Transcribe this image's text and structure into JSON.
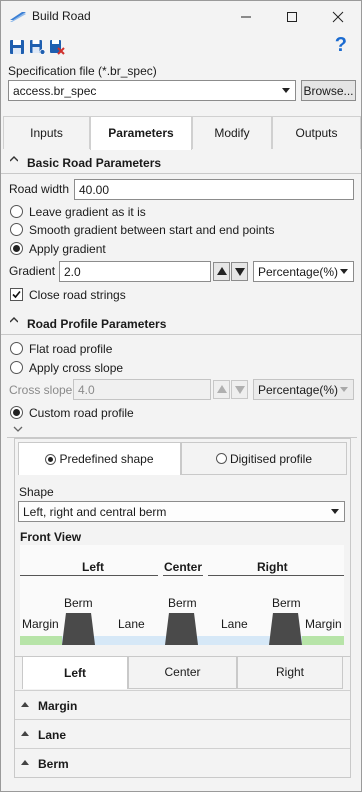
{
  "window": {
    "title": "Build Road"
  },
  "toolbar": {
    "save_icon": "save-icon",
    "save_as_icon": "save-as-icon",
    "delete_icon": "delete-icon",
    "help_label": "?"
  },
  "spec": {
    "label": "Specification file (*.br_spec)",
    "value": "access.br_spec",
    "browse_label": "Browse..."
  },
  "tabs": [
    {
      "label": "Inputs",
      "active": false
    },
    {
      "label": "Parameters",
      "active": true
    },
    {
      "label": "Modify",
      "active": false
    },
    {
      "label": "Outputs",
      "active": false
    }
  ],
  "basic": {
    "title": "Basic Road Parameters",
    "road_width_label": "Road width",
    "road_width_value": "40.00",
    "options": [
      "Leave gradient as it is",
      "Smooth gradient between start and end points",
      "Apply gradient"
    ],
    "selected_option": 2,
    "gradient_label": "Gradient",
    "gradient_value": "2.0",
    "gradient_unit": "Percentage(%)",
    "close_strings_label": "Close road strings",
    "close_strings_checked": true
  },
  "profile": {
    "title": "Road Profile Parameters",
    "options": [
      "Flat road profile",
      "Apply cross slope"
    ],
    "cross_slope_label": "Cross slope",
    "cross_slope_value": "4.0",
    "cross_slope_unit": "Percentage(%)",
    "custom_label": "Custom road profile",
    "selected": "custom"
  },
  "shape_tabs": [
    {
      "label": "Predefined shape",
      "selected": true
    },
    {
      "label": "Digitised profile",
      "selected": false
    }
  ],
  "shape": {
    "label": "Shape",
    "value": "Left, right and central berm"
  },
  "front_view": {
    "title": "Front View",
    "sections": [
      "Left",
      "Center",
      "Right"
    ],
    "parts": {
      "margin_left": "Margin",
      "berm_left": "Berm",
      "lane_left": "Lane",
      "berm_center": "Berm",
      "lane_right": "Lane",
      "berm_right": "Berm",
      "margin_right": "Margin"
    },
    "colors": {
      "margin": "#b7e4a8",
      "lane": "#d6e8f7",
      "berm": "#4a4a4a"
    }
  },
  "side_tabs": [
    {
      "label": "Left",
      "active": true
    },
    {
      "label": "Center",
      "active": false
    },
    {
      "label": "Right",
      "active": false
    }
  ],
  "accordion": [
    "Margin",
    "Lane",
    "Berm"
  ]
}
